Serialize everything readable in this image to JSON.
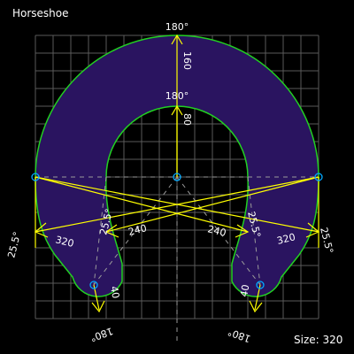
{
  "title": "Horseshoe",
  "size_label": "Size: 320",
  "colors": {
    "background": "#000000",
    "grid": "#5a5a5a",
    "fill": "#2a1460",
    "outline": "#22d022",
    "dimension": "#ffff00",
    "pin": "#00aaff",
    "text": "#ffffff"
  },
  "labels": {
    "outer_angle": "180°",
    "outer_radius": "160",
    "inner_angle": "180°",
    "inner_radius": "80",
    "left_inner_angle": "25.5°",
    "left_inner_length": "240",
    "right_inner_angle": "25.5°",
    "right_inner_length": "240",
    "left_outer_angle": "25.5°",
    "left_outer_length": "320",
    "right_outer_angle": "25.5°",
    "right_outer_length": "320",
    "left_tip_angle": "180°",
    "left_tip_radius": "40",
    "right_tip_angle": "180°",
    "right_tip_radius": "40"
  }
}
